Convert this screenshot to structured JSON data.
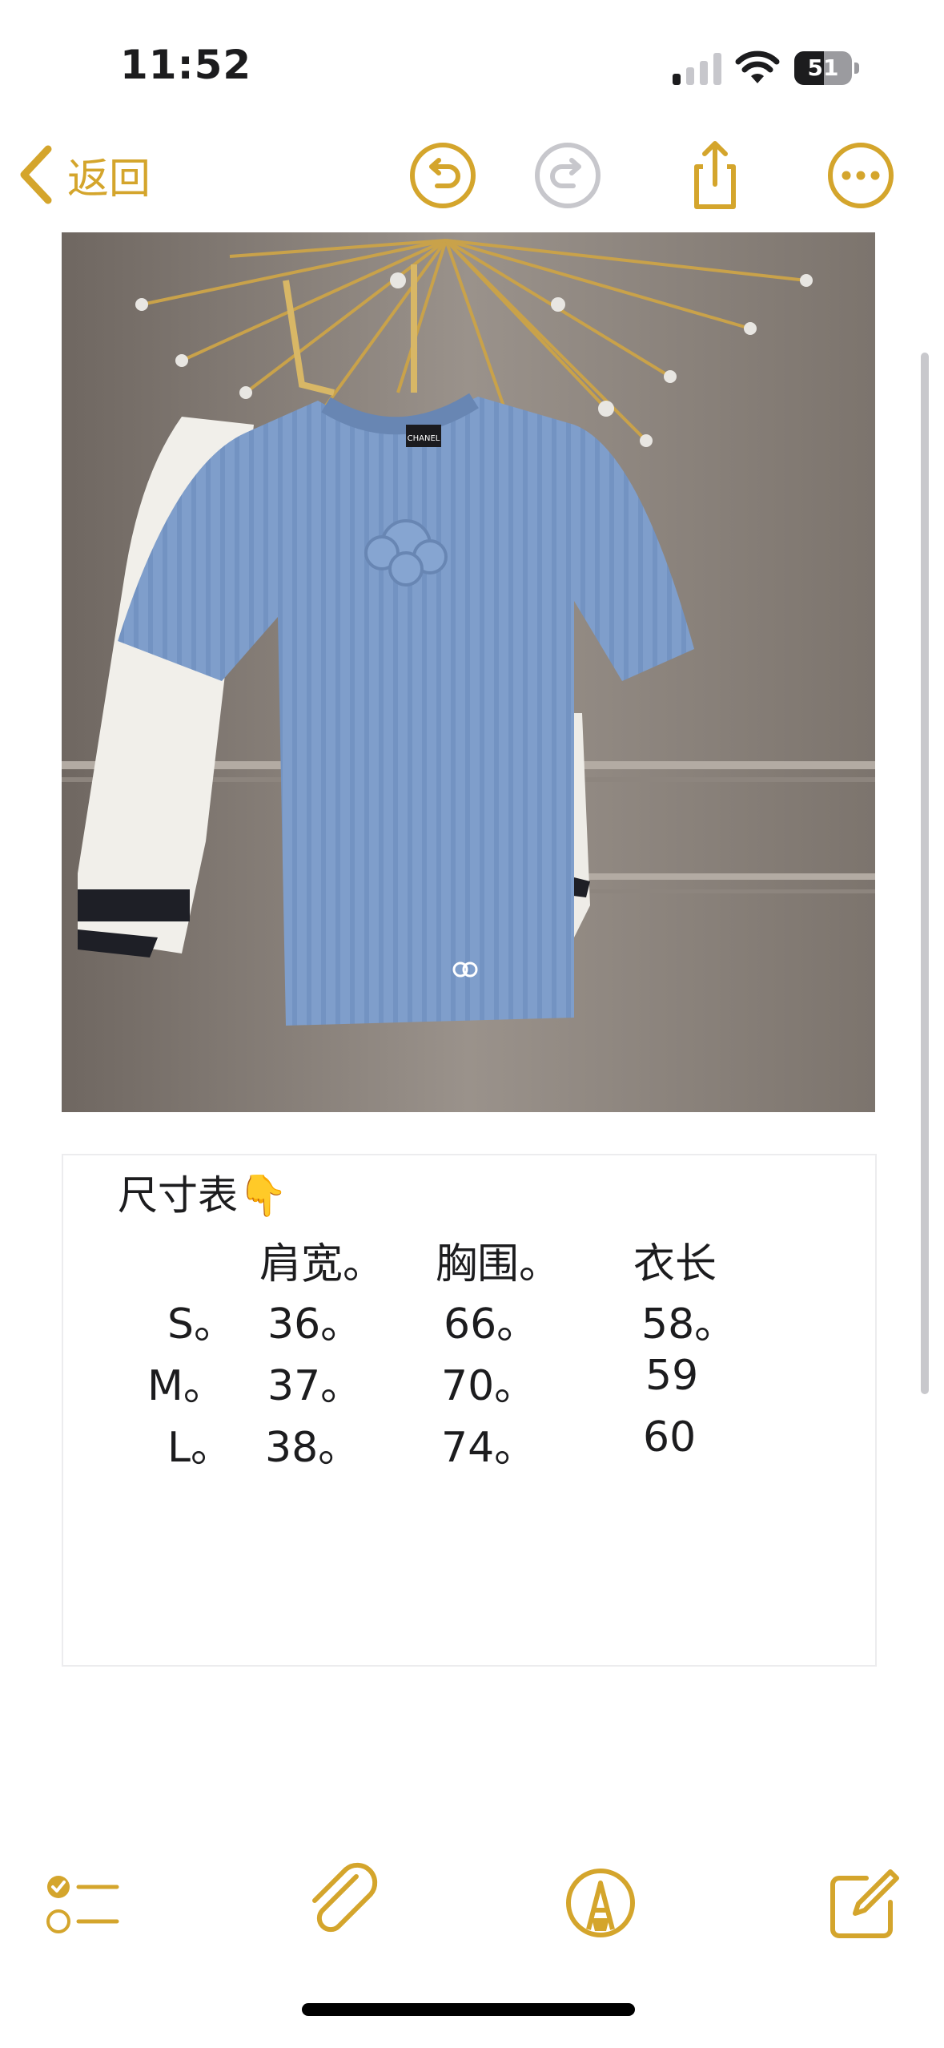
{
  "status_bar": {
    "time": "11:52",
    "battery": "51",
    "battery_level": 0.51,
    "signal_bars_filled": 1
  },
  "toolbar": {
    "back_label": "返回",
    "icons": [
      "chevron-left-icon",
      "undo-icon",
      "redo-icon",
      "share-icon",
      "more-icon"
    ]
  },
  "accent_color": "#d4a52c",
  "note": {
    "size_table": {
      "title": "尺寸表",
      "title_emoji": "👇",
      "headers": [
        "肩宽。",
        "胸围。",
        "衣长"
      ],
      "rows": [
        {
          "size": "S。",
          "values": [
            "36。",
            "66。",
            "58。"
          ]
        },
        {
          "size": "M。",
          "values": [
            "37。",
            "70。",
            "59"
          ]
        },
        {
          "size": "L。",
          "values": [
            "38。",
            "74。",
            "60"
          ]
        }
      ]
    },
    "photo_label": "CHANEL"
  },
  "bottom_toolbar": {
    "icons": [
      "checklist-icon",
      "paperclip-icon",
      "markup-icon",
      "compose-icon"
    ]
  }
}
